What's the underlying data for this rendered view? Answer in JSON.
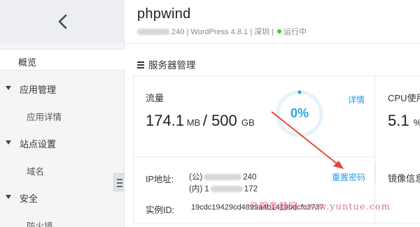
{
  "sidebar": {
    "back_icon": "chevron-left-icon",
    "items": [
      {
        "label": "概览",
        "type": "item",
        "active": true
      },
      {
        "label": "应用管理",
        "type": "group"
      },
      {
        "label": "应用详情",
        "type": "sub"
      },
      {
        "label": "站点设置",
        "type": "group"
      },
      {
        "label": "域名",
        "type": "sub"
      },
      {
        "label": "安全",
        "type": "group"
      },
      {
        "label": "防火墙",
        "type": "sub"
      }
    ]
  },
  "header": {
    "title": "phpwind",
    "ip_suffix": ".240",
    "app_version": "WordPress 4.8.1",
    "region": "深圳",
    "status": "运行中",
    "status_color": "#52c41a"
  },
  "section": {
    "title": "服务器管理",
    "icon": "list-icon"
  },
  "traffic": {
    "label": "流量",
    "used": "174.1",
    "used_unit": "MB",
    "separator": "/",
    "total": "500",
    "total_unit": "GB",
    "percent_text": "0%",
    "percent": 0,
    "details_link": "详情"
  },
  "cpu": {
    "label": "CPU使用",
    "value": "5.1",
    "unit": "%"
  },
  "network": {
    "ip_label": "IP地址:",
    "public_prefix": "(公)",
    "public_suffix": "240",
    "private_prefix": "(内)",
    "private_mid": "1",
    "private_suffix": "172",
    "reset_password_link": "重置密码",
    "mirror_label": "镜像信息"
  },
  "instance": {
    "label": "实例ID:",
    "id": "19cdc19429cd4899a4b1419bdcfc3737"
  },
  "watermark": "云服务器网 www.yuntue.com",
  "colors": {
    "accent": "#29a3e3",
    "link": "#2a9ce0",
    "annotation_arrow": "#e8412e"
  }
}
